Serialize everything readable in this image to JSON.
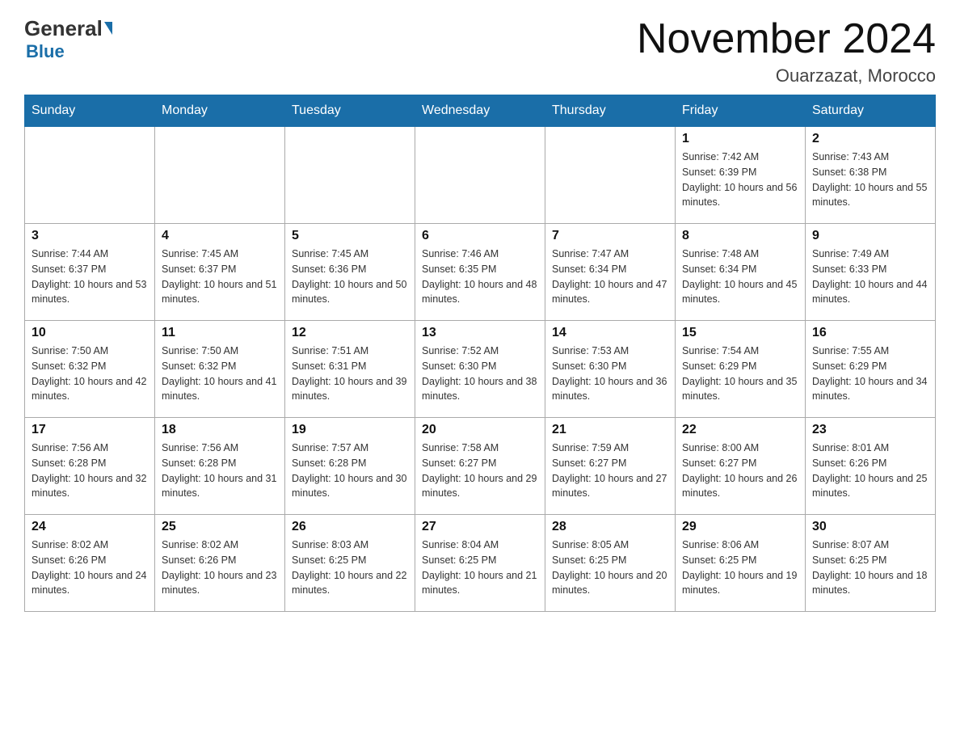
{
  "logo": {
    "general": "General",
    "blue": "Blue"
  },
  "title": "November 2024",
  "location": "Ouarzazat, Morocco",
  "days_of_week": [
    "Sunday",
    "Monday",
    "Tuesday",
    "Wednesday",
    "Thursday",
    "Friday",
    "Saturday"
  ],
  "weeks": [
    [
      {
        "day": "",
        "info": ""
      },
      {
        "day": "",
        "info": ""
      },
      {
        "day": "",
        "info": ""
      },
      {
        "day": "",
        "info": ""
      },
      {
        "day": "",
        "info": ""
      },
      {
        "day": "1",
        "info": "Sunrise: 7:42 AM\nSunset: 6:39 PM\nDaylight: 10 hours and 56 minutes."
      },
      {
        "day": "2",
        "info": "Sunrise: 7:43 AM\nSunset: 6:38 PM\nDaylight: 10 hours and 55 minutes."
      }
    ],
    [
      {
        "day": "3",
        "info": "Sunrise: 7:44 AM\nSunset: 6:37 PM\nDaylight: 10 hours and 53 minutes."
      },
      {
        "day": "4",
        "info": "Sunrise: 7:45 AM\nSunset: 6:37 PM\nDaylight: 10 hours and 51 minutes."
      },
      {
        "day": "5",
        "info": "Sunrise: 7:45 AM\nSunset: 6:36 PM\nDaylight: 10 hours and 50 minutes."
      },
      {
        "day": "6",
        "info": "Sunrise: 7:46 AM\nSunset: 6:35 PM\nDaylight: 10 hours and 48 minutes."
      },
      {
        "day": "7",
        "info": "Sunrise: 7:47 AM\nSunset: 6:34 PM\nDaylight: 10 hours and 47 minutes."
      },
      {
        "day": "8",
        "info": "Sunrise: 7:48 AM\nSunset: 6:34 PM\nDaylight: 10 hours and 45 minutes."
      },
      {
        "day": "9",
        "info": "Sunrise: 7:49 AM\nSunset: 6:33 PM\nDaylight: 10 hours and 44 minutes."
      }
    ],
    [
      {
        "day": "10",
        "info": "Sunrise: 7:50 AM\nSunset: 6:32 PM\nDaylight: 10 hours and 42 minutes."
      },
      {
        "day": "11",
        "info": "Sunrise: 7:50 AM\nSunset: 6:32 PM\nDaylight: 10 hours and 41 minutes."
      },
      {
        "day": "12",
        "info": "Sunrise: 7:51 AM\nSunset: 6:31 PM\nDaylight: 10 hours and 39 minutes."
      },
      {
        "day": "13",
        "info": "Sunrise: 7:52 AM\nSunset: 6:30 PM\nDaylight: 10 hours and 38 minutes."
      },
      {
        "day": "14",
        "info": "Sunrise: 7:53 AM\nSunset: 6:30 PM\nDaylight: 10 hours and 36 minutes."
      },
      {
        "day": "15",
        "info": "Sunrise: 7:54 AM\nSunset: 6:29 PM\nDaylight: 10 hours and 35 minutes."
      },
      {
        "day": "16",
        "info": "Sunrise: 7:55 AM\nSunset: 6:29 PM\nDaylight: 10 hours and 34 minutes."
      }
    ],
    [
      {
        "day": "17",
        "info": "Sunrise: 7:56 AM\nSunset: 6:28 PM\nDaylight: 10 hours and 32 minutes."
      },
      {
        "day": "18",
        "info": "Sunrise: 7:56 AM\nSunset: 6:28 PM\nDaylight: 10 hours and 31 minutes."
      },
      {
        "day": "19",
        "info": "Sunrise: 7:57 AM\nSunset: 6:28 PM\nDaylight: 10 hours and 30 minutes."
      },
      {
        "day": "20",
        "info": "Sunrise: 7:58 AM\nSunset: 6:27 PM\nDaylight: 10 hours and 29 minutes."
      },
      {
        "day": "21",
        "info": "Sunrise: 7:59 AM\nSunset: 6:27 PM\nDaylight: 10 hours and 27 minutes."
      },
      {
        "day": "22",
        "info": "Sunrise: 8:00 AM\nSunset: 6:27 PM\nDaylight: 10 hours and 26 minutes."
      },
      {
        "day": "23",
        "info": "Sunrise: 8:01 AM\nSunset: 6:26 PM\nDaylight: 10 hours and 25 minutes."
      }
    ],
    [
      {
        "day": "24",
        "info": "Sunrise: 8:02 AM\nSunset: 6:26 PM\nDaylight: 10 hours and 24 minutes."
      },
      {
        "day": "25",
        "info": "Sunrise: 8:02 AM\nSunset: 6:26 PM\nDaylight: 10 hours and 23 minutes."
      },
      {
        "day": "26",
        "info": "Sunrise: 8:03 AM\nSunset: 6:25 PM\nDaylight: 10 hours and 22 minutes."
      },
      {
        "day": "27",
        "info": "Sunrise: 8:04 AM\nSunset: 6:25 PM\nDaylight: 10 hours and 21 minutes."
      },
      {
        "day": "28",
        "info": "Sunrise: 8:05 AM\nSunset: 6:25 PM\nDaylight: 10 hours and 20 minutes."
      },
      {
        "day": "29",
        "info": "Sunrise: 8:06 AM\nSunset: 6:25 PM\nDaylight: 10 hours and 19 minutes."
      },
      {
        "day": "30",
        "info": "Sunrise: 8:07 AM\nSunset: 6:25 PM\nDaylight: 10 hours and 18 minutes."
      }
    ]
  ]
}
